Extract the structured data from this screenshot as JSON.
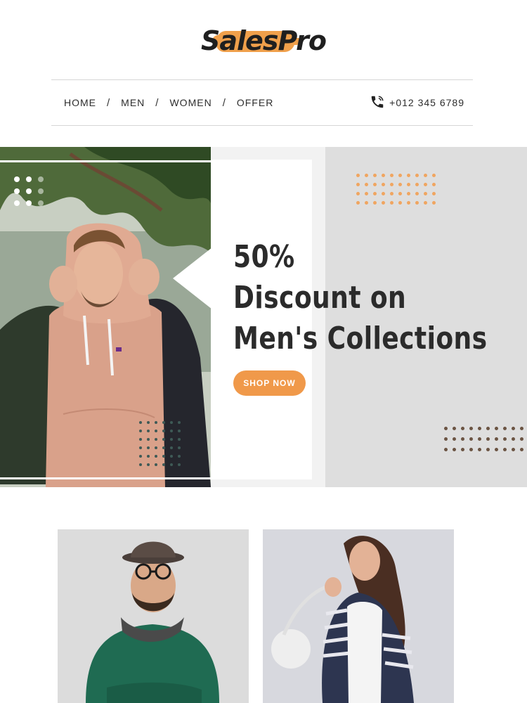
{
  "brand": {
    "name": "SalesPro",
    "accent": "#f0a04b"
  },
  "nav": {
    "items": [
      {
        "label": "HOME"
      },
      {
        "label": "MEN"
      },
      {
        "label": "WOMEN"
      },
      {
        "label": "OFFER"
      }
    ],
    "separator": "/",
    "phone": {
      "icon": "phone-icon",
      "number": "+012 345 6789"
    }
  },
  "hero": {
    "title_line1": "50%",
    "title_line2": "Discount on",
    "title_line3": "Men's Collections",
    "button_label": "SHOP NOW",
    "button_color": "#f0994a",
    "image": "man-in-pink-hoodie-photo"
  },
  "products": [
    {
      "image": "man-with-hat-glasses-green-sweater-photo"
    },
    {
      "image": "woman-striped-cardigan-handbag-photo"
    }
  ]
}
